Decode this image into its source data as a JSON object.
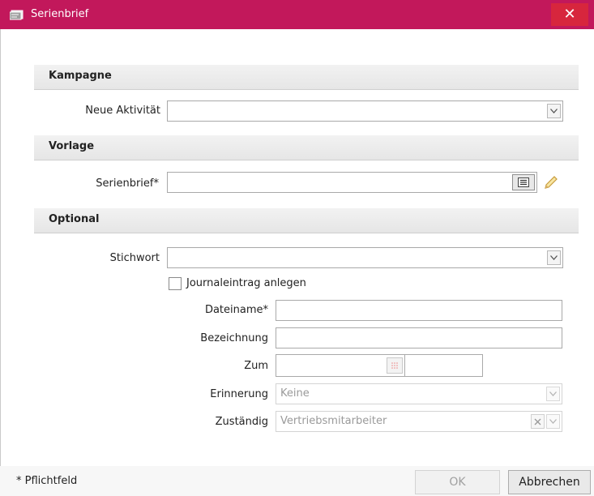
{
  "window": {
    "title": "Serienbrief",
    "close_glyph": "✕"
  },
  "sections": {
    "kampagne": "Kampagne",
    "vorlage": "Vorlage",
    "optional": "Optional"
  },
  "fields": {
    "neue_aktivitaet": {
      "label": "Neue Aktivität",
      "value": ""
    },
    "serienbrief": {
      "label": "Serienbrief*",
      "value": ""
    },
    "stichwort": {
      "label": "Stichwort",
      "value": ""
    },
    "journal_checkbox": {
      "label": "Journaleintrag anlegen",
      "checked": false
    },
    "dateiname": {
      "label": "Dateiname*",
      "value": ""
    },
    "bezeichnung": {
      "label": "Bezeichnung",
      "value": ""
    },
    "zum": {
      "label": "Zum",
      "value": ""
    },
    "erinnerung": {
      "label": "Erinnerung",
      "value": "Keine"
    },
    "zustaendig": {
      "label": "Zuständig",
      "value": "Vertriebsmitarbeiter"
    }
  },
  "footer": {
    "required_note": "* Pflichtfeld",
    "ok_label": "OK",
    "cancel_label": "Abbrechen"
  },
  "icons": {
    "title": "mail-merge-icon",
    "list": "list-icon",
    "edit": "pencil-icon",
    "calendar": "calendar-icon",
    "dropdown": "chevron-down-icon",
    "clear": "clear-icon"
  },
  "colors": {
    "titlebar": "#c2185b",
    "close_button": "#d7263d"
  }
}
